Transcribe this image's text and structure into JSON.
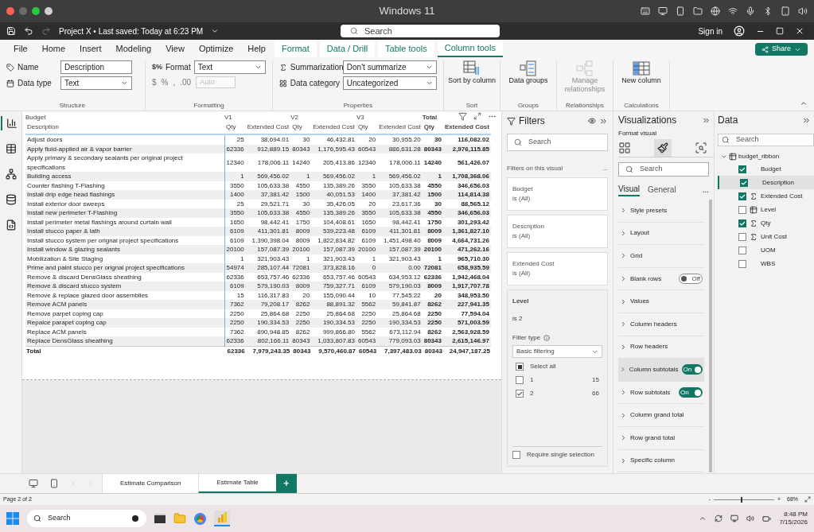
{
  "os_bar": {
    "title": "Windows 11"
  },
  "title_bar": {
    "document": "Project X • Last saved: Today at 6:23 PM",
    "search": {
      "placeholder": "Search"
    },
    "sign_in": "Sign in"
  },
  "tabs": [
    {
      "label": "File",
      "selected": false,
      "contextual": false
    },
    {
      "label": "Home",
      "selected": false,
      "contextual": false
    },
    {
      "label": "Insert",
      "selected": false,
      "contextual": false
    },
    {
      "label": "Modeling",
      "selected": false,
      "contextual": false
    },
    {
      "label": "View",
      "selected": false,
      "contextual": false
    },
    {
      "label": "Optimize",
      "selected": false,
      "contextual": false
    },
    {
      "label": "Help",
      "selected": false,
      "contextual": false
    },
    {
      "label": "Format",
      "selected": false,
      "contextual": true
    },
    {
      "label": "Data / Drill",
      "selected": false,
      "contextual": true
    },
    {
      "label": "Table tools",
      "selected": false,
      "contextual": true
    },
    {
      "label": "Column tools",
      "selected": true,
      "contextual": true
    }
  ],
  "share_button": "Share",
  "ribbon": {
    "structure": {
      "name_label": "Name",
      "name_value": "Description",
      "data_type_label": "Data type",
      "data_type_value": "Text",
      "group": "Structure"
    },
    "formatting": {
      "format_icon": "$%",
      "format_label": "Format",
      "format_value": "Text",
      "buttons": [
        "$",
        "%",
        ",",
        ".00"
      ],
      "auto_placeholder": "Auto",
      "group": "Formatting"
    },
    "properties": {
      "summarization_label": "Summarization",
      "summarization_value": "Don't summarize",
      "category_label": "Data category",
      "category_value": "Uncategorized",
      "group": "Properties"
    },
    "buttons": [
      {
        "label": "Sort by column",
        "group": "Sort",
        "disabled": false,
        "kind": "sort"
      },
      {
        "label": "Data groups",
        "group": "Groups",
        "disabled": false,
        "kind": "groups"
      },
      {
        "label": "Manage relationships",
        "group": "Relationships",
        "disabled": true,
        "kind": "relationships"
      },
      {
        "label": "New column",
        "group": "Calculations",
        "disabled": false,
        "kind": "column"
      }
    ]
  },
  "rail": [
    {
      "kind": "report",
      "selected": true
    },
    {
      "kind": "table",
      "selected": false
    },
    {
      "kind": "model",
      "selected": false
    },
    {
      "kind": "dax",
      "selected": false
    },
    {
      "kind": "tmdl",
      "selected": false
    }
  ],
  "table": {
    "group_headers": [
      "Budget",
      "V1",
      "V2",
      "V3",
      "Total"
    ],
    "columns": [
      "Description",
      "Qty",
      "Extended Cost",
      "Qty",
      "Extended Cost",
      "Qty",
      "Extended Cost",
      "Qty",
      "Extended Cost"
    ],
    "rows": [
      [
        "Adjust doors",
        "25",
        "38,694.01",
        "30",
        "46,432.81",
        "20",
        "30,955.20",
        "30",
        "116,082.02"
      ],
      [
        "Apply fluid-applied air & vapor barrier",
        "62336",
        "912,889.15",
        "80343",
        "1,176,595.43",
        "60543",
        "886,631.28",
        "80343",
        "2,976,115.85"
      ],
      [
        "Apply primary & secondary sealants per original project specifications",
        "12340",
        "178,006.11",
        "14240",
        "205,413.86",
        "12340",
        "178,006.11",
        "14240",
        "561,426.07"
      ],
      [
        "Building access",
        "1",
        "569,456.02",
        "1",
        "569,456.02",
        "1",
        "569,456.02",
        "1",
        "1,708,368.06"
      ],
      [
        "Counter flashing T-Flashing",
        "3550",
        "105,633.38",
        "4550",
        "135,389.26",
        "3550",
        "105,633.38",
        "4550",
        "346,656.03"
      ],
      [
        "Install drip edge head flashings",
        "1400",
        "37,381.42",
        "1500",
        "40,051.53",
        "1400",
        "37,381.42",
        "1500",
        "114,814.38"
      ],
      [
        "Install exterior door sweeps",
        "25",
        "29,521.71",
        "30",
        "35,426.05",
        "20",
        "23,617.36",
        "30",
        "88,565.12"
      ],
      [
        "Install new perimeter T-Flashing",
        "3550",
        "105,633.38",
        "4550",
        "135,389.26",
        "3550",
        "105,633.38",
        "4550",
        "346,656.03"
      ],
      [
        "Install perimeter metal flashings around curtain wall",
        "1650",
        "98,442.41",
        "1750",
        "104,408.61",
        "1650",
        "98,442.41",
        "1750",
        "301,293.42"
      ],
      [
        "Install stucco paper & lath",
        "6109",
        "411,301.81",
        "8009",
        "539,223.48",
        "6109",
        "411,301.81",
        "8009",
        "1,361,827.10"
      ],
      [
        "Install stucco system per orignal project specifications",
        "6109",
        "1,390,398.04",
        "8009",
        "1,822,834.82",
        "6109",
        "1,451,498.40",
        "8009",
        "4,664,731.26"
      ],
      [
        "Install window & glazing sealants",
        "20100",
        "157,087.39",
        "20100",
        "157,087.39",
        "20100",
        "157,087.39",
        "20100",
        "471,262.16"
      ],
      [
        "Mobilization & Site Staging",
        "1",
        "321,903.43",
        "1",
        "321,903.43",
        "1",
        "321,903.43",
        "1",
        "965,710.30"
      ],
      [
        "Prime and paint stucco per orignal project specifications",
        "54974",
        "285,107.44",
        "72081",
        "373,828.16",
        "0",
        "0.00",
        "72081",
        "658,935.59"
      ],
      [
        "Remove & discard DensGlass sheathing",
        "62336",
        "653,757.46",
        "62336",
        "653,757.46",
        "60543",
        "634,953.12",
        "62336",
        "1,942,468.04"
      ],
      [
        "Remove & discard stucco system",
        "6109",
        "579,190.03",
        "8009",
        "759,327.71",
        "6109",
        "579,190.03",
        "8009",
        "1,917,707.78"
      ],
      [
        "Remove & replace glazed door assemblies",
        "15",
        "116,317.83",
        "20",
        "155,090.44",
        "10",
        "77,545.22",
        "20",
        "348,953.50"
      ],
      [
        "Remove ACM panels",
        "7362",
        "79,208.17",
        "8262",
        "88,891.32",
        "5562",
        "59,841.87",
        "8262",
        "227,941.35"
      ],
      [
        "Remove parpet coping cap",
        "2250",
        "25,864.68",
        "2250",
        "25,864.68",
        "2250",
        "25,864.68",
        "2250",
        "77,594.04"
      ],
      [
        "Repalce parapet coping cap",
        "2250",
        "190,334.53",
        "2250",
        "190,334.53",
        "2250",
        "190,334.53",
        "2250",
        "571,003.59"
      ],
      [
        "Replace ACM panels",
        "7362",
        "890,948.85",
        "8262",
        "999,866.80",
        "5562",
        "673,112.94",
        "8262",
        "2,563,928.59"
      ],
      [
        "Replace DensGlass sheathing",
        "62336",
        "802,166.11",
        "80343",
        "1,033,807.83",
        "60543",
        "779,093.03",
        "80343",
        "2,615,146.97"
      ]
    ],
    "total": [
      "Total",
      "62336",
      "7,979,243.35",
      "80343",
      "9,570,460.87",
      "60543",
      "7,397,483.03",
      "80343",
      "24,947,187.25"
    ]
  },
  "filters": {
    "title": "Filters",
    "search": {
      "placeholder": "Search"
    },
    "section": "Filters on this visual",
    "more": "...",
    "cards": [
      {
        "field": "Budget",
        "condition": "is (All)"
      },
      {
        "field": "Description",
        "condition": "is (All)"
      },
      {
        "field": "Extended Cost",
        "condition": "is (All)"
      }
    ],
    "level": {
      "field": "Level",
      "condition": "is 2",
      "filter_type_label": "Filter type",
      "filter_type": "Basic filtering",
      "options": [
        {
          "label": "Select all",
          "checked": false,
          "partial": true
        },
        {
          "label": "1",
          "count": "15",
          "checked": false,
          "partial": false
        },
        {
          "label": "2",
          "count": "66",
          "checked": true,
          "partial": false
        }
      ],
      "require_single": {
        "label": "Require single selection",
        "checked": false
      }
    }
  },
  "visualizations": {
    "title": "Visualizations",
    "subtitle": "Format visual",
    "search": {
      "placeholder": "Search"
    },
    "tabs": [
      {
        "label": "Visual",
        "selected": true
      },
      {
        "label": "General",
        "selected": false
      }
    ],
    "more": "...",
    "sections": [
      {
        "label": "Style presets",
        "kind": "plain",
        "highlighted": false
      },
      {
        "label": "Layout",
        "kind": "plain",
        "highlighted": false
      },
      {
        "label": "Grid",
        "kind": "plain",
        "highlighted": false
      },
      {
        "label": "Blank rows",
        "kind": "toggle",
        "on": false,
        "toggle_label": "Off",
        "highlighted": false
      },
      {
        "label": "Values",
        "kind": "plain",
        "highlighted": false
      },
      {
        "label": "Column headers",
        "kind": "plain",
        "highlighted": false
      },
      {
        "label": "Row headers",
        "kind": "plain",
        "highlighted": false
      },
      {
        "label": "Column subtotals",
        "kind": "toggle",
        "on": true,
        "toggle_label": "On",
        "highlighted": true
      },
      {
        "label": "Row subtotals",
        "kind": "toggle",
        "on": true,
        "toggle_label": "On",
        "highlighted": false
      },
      {
        "label": "Column grand total",
        "kind": "plain",
        "highlighted": false
      },
      {
        "label": "Row grand total",
        "kind": "plain",
        "highlighted": false
      },
      {
        "label": "Specific column",
        "kind": "plain",
        "highlighted": false
      }
    ]
  },
  "data": {
    "title": "Data",
    "search": {
      "placeholder": "Search"
    },
    "tree": [
      {
        "label": "budget_ribbon",
        "expanded": true,
        "children": [
          {
            "label": "Budget",
            "checked": true,
            "kind": "text",
            "selected": false
          },
          {
            "label": "Description",
            "checked": true,
            "kind": "text",
            "selected": true
          },
          {
            "label": "Extended Cost",
            "checked": true,
            "kind": "sum",
            "selected": false
          },
          {
            "label": "Level",
            "checked": false,
            "kind": "hierarchy",
            "selected": false
          },
          {
            "label": "Qty",
            "checked": true,
            "kind": "sum",
            "selected": false
          },
          {
            "label": "Unit Cost",
            "checked": false,
            "kind": "sum",
            "selected": false
          },
          {
            "label": "UOM",
            "checked": false,
            "kind": "text",
            "selected": false
          },
          {
            "label": "WBS",
            "checked": false,
            "kind": "text",
            "selected": false
          }
        ]
      }
    ]
  },
  "page_tabs": [
    {
      "label": "Estimate Comparison",
      "selected": false
    },
    {
      "label": "Estimate Table",
      "selected": true
    }
  ],
  "add_page": "+",
  "status_bar": {
    "page": "Page 2 of 2",
    "zoom_minus": "-",
    "zoom_plus": "+",
    "zoom": "68%",
    "level": 0.45
  },
  "taskbar": {
    "search": {
      "placeholder": "Search"
    },
    "time": "8:48 PM",
    "date": "7/15/2026"
  }
}
